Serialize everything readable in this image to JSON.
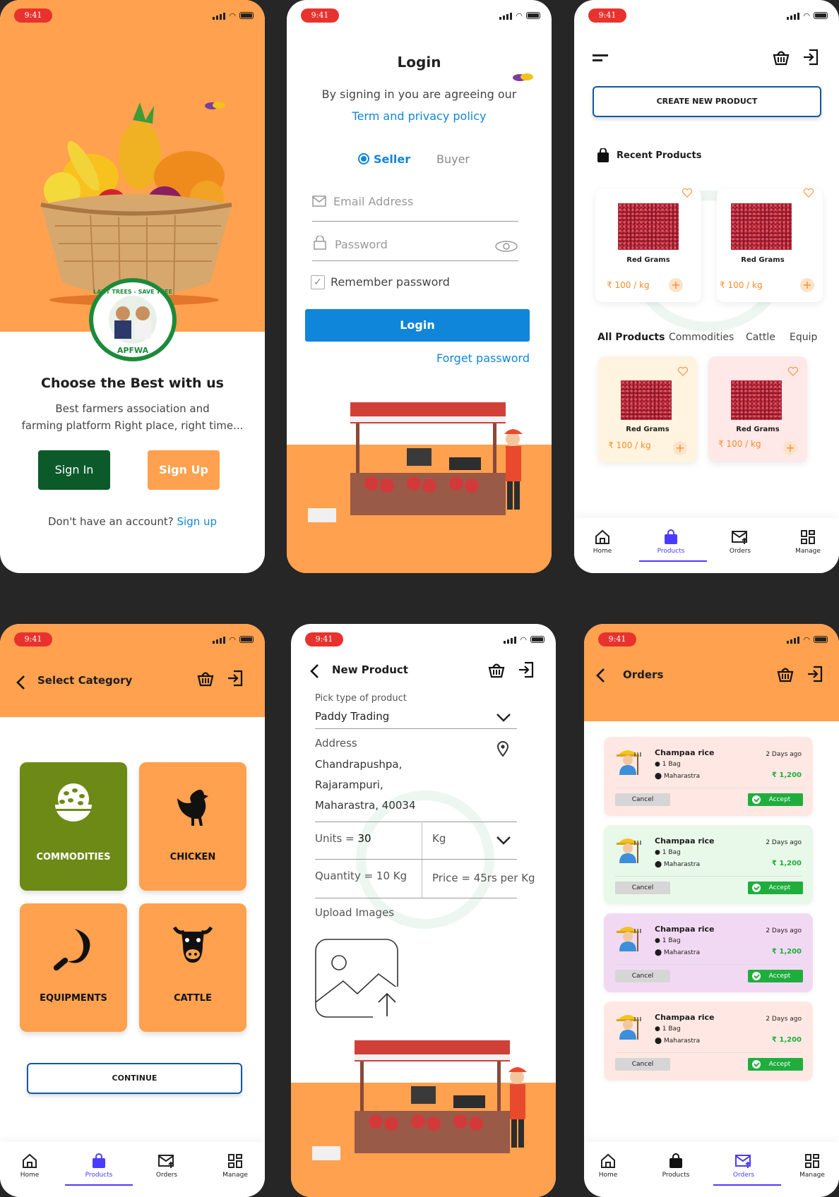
{
  "status": {
    "time": "9:41"
  },
  "welcome": {
    "logo_ring_text": "PLANT TREES - SAVE TREES",
    "logo_bottom_text": "APFWA",
    "headline": "Choose the Best with us",
    "description_line1": "Best farmers association and",
    "description_line2": "farming platform Right place, right time...",
    "signin_label": "Sign In",
    "signup_label": "Sign Up",
    "no_account_text": "Don't have an account?",
    "signup_link": "Sign up"
  },
  "login": {
    "title": "Login",
    "agreement_text": "By signing in you are agreeing our",
    "terms_link": "Term and privacy policy",
    "role_seller": "Seller",
    "role_buyer": "Buyer",
    "email_placeholder": "Email Address",
    "password_placeholder": "Password",
    "remember_label": "Remember password",
    "login_button": "Login",
    "forget_link": "Forget password"
  },
  "products": {
    "create_button": "CREATE NEW PRODUCT",
    "recent_title": "Recent Products",
    "recent": [
      {
        "name": "Red Grams",
        "price": "₹ 100 / kg"
      },
      {
        "name": "Red Grams",
        "price": "₹ 100 / kg"
      }
    ],
    "tabs": [
      "All Products",
      "Commodities",
      "Cattle",
      "Equip"
    ],
    "all": [
      {
        "name": "Red Grams",
        "price": "₹ 100 / kg"
      },
      {
        "name": "Red Grams",
        "price": "₹ 100 / kg"
      }
    ]
  },
  "nav": {
    "home": "Home",
    "products": "Products",
    "orders": "Orders",
    "manage": "Manage"
  },
  "category": {
    "title": "Select Category",
    "items": [
      "COMMODITIES",
      "CHICKEN",
      "EQUIPMENTS",
      "CATTLE"
    ],
    "continue": "CONTINUE"
  },
  "new_product": {
    "title": "New Product",
    "type_label": "Pick type of product",
    "type_value": "Paddy Trading",
    "address_label": "Address",
    "address_line1": "Chandrapushpa,",
    "address_line2": "Rajarampuri,",
    "address_line3": "Maharastra, 40034",
    "units_label": "Units = ",
    "units_value": "30",
    "unit_value": "Kg",
    "quantity_text": "Quantity = 10 Kg",
    "price_text": "Price = 45rs per Kg",
    "upload_label": "Upload Images"
  },
  "orders": {
    "title": "Orders",
    "items": [
      {
        "name": "Champaa rice",
        "ago": "2 Days ago",
        "qty": "1 Bag",
        "location": "Maharastra",
        "amount": "₹ 1,200",
        "cancel": "Cancel",
        "accept": "Accept",
        "color": "#ffe8e3"
      },
      {
        "name": "Champaa rice",
        "ago": "2 Days ago",
        "qty": "1 Bag",
        "location": "Maharastra",
        "amount": "₹ 1,200",
        "cancel": "Cancel",
        "accept": "Accept",
        "color": "#e8f8e9"
      },
      {
        "name": "Champaa rice",
        "ago": "2 Days ago",
        "qty": "1 Bag",
        "location": "Maharastra",
        "amount": "₹ 1,200",
        "cancel": "Cancel",
        "accept": "Accept",
        "color": "#f2d9f3"
      },
      {
        "name": "Champaa rice",
        "ago": "2 Days ago",
        "qty": "1 Bag",
        "location": "Maharastra",
        "amount": "₹ 1,200",
        "cancel": "Cancel",
        "accept": "Accept",
        "color": "#ffe8e3"
      }
    ]
  },
  "colors": {
    "orange": "#ffa14e",
    "primary_blue": "#0f86d9",
    "dark_green": "#0c5a2a",
    "olive": "#6e8a16",
    "active_nav": "#4a3cff"
  }
}
